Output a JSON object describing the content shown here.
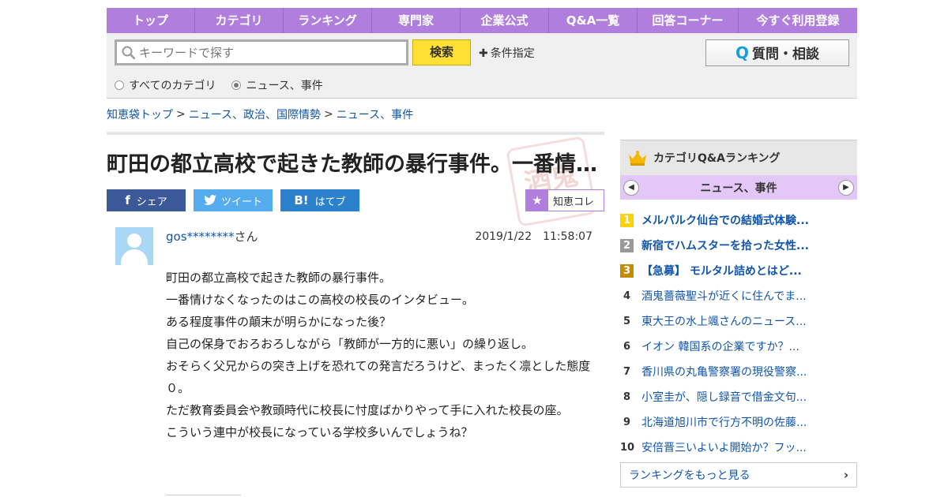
{
  "nav": {
    "items": [
      "トップ",
      "カテゴリ",
      "ランキング",
      "専門家",
      "企業公式",
      "Q&A一覧",
      "回答コーナー",
      "今すぐ利用登録"
    ]
  },
  "search": {
    "placeholder": "キーワードで探す",
    "button_label": "検索",
    "condition_label": "条件指定",
    "ask_label": "質問・相談",
    "radio_all": "すべてのカテゴリ",
    "radio_current": "ニュース、事件",
    "selected": "ニュース、事件"
  },
  "breadcrumb": {
    "items": [
      "知恵袋トップ",
      "ニュース、政治、国際情勢",
      "ニュース、事件"
    ],
    "separator": ">"
  },
  "question": {
    "title": "町田の都立高校で起きた教師の暴行事件。一番情けなくなったのはこの高校の校長のインタビュー。",
    "user_name": "gos********",
    "user_suffix": "さん",
    "timestamp": "2019/1/22　11:58:07",
    "body": [
      "町田の都立高校で起きた教師の暴行事件。",
      "一番情けなくなったのはこの高校の校長のインタビュー。",
      "ある程度事件の顛末が明らかになった後？",
      "自己の保身でおろおろしながら「教師が一方的に悪い」の繰り返し。",
      "おそらく父兄からの突き上げを恐れての発言だろうけど、まったく凛とした態度０。",
      "ただ教育委員会や教頭時代に校長に忖度ばかりやって手に入れた校長の座。",
      "こういう連中が校長になっている学校多いんでしょうね？"
    ],
    "stamp_text": "酒鬼"
  },
  "share": {
    "facebook": "シェア",
    "twitter": "ツイート",
    "hatena": "はてブ",
    "chiecolle": "知恵コレ"
  },
  "sidebar": {
    "title": "カテゴリQ&Aランキング",
    "category": "ニュース、事件",
    "ranking": [
      {
        "rank": "1",
        "text": "メルパルク仙台での結婚式体験..."
      },
      {
        "rank": "2",
        "text": "新宿でハムスターを拾った女性..."
      },
      {
        "rank": "3",
        "text": "【急募】 モルタル詰めとはど..."
      },
      {
        "rank": "4",
        "text": "酒鬼薔薇聖斗が近くに住んでま..."
      },
      {
        "rank": "5",
        "text": "東大王の水上颯さんのニュース..."
      },
      {
        "rank": "6",
        "text": "イオン 韓国系の企業ですか？..."
      },
      {
        "rank": "7",
        "text": "香川県の丸亀警察署の現役警察..."
      },
      {
        "rank": "8",
        "text": "小室圭が、隠し録音で借金文句..."
      },
      {
        "rank": "9",
        "text": "北海道旭川市で行方不明の佐藤..."
      },
      {
        "rank": "10",
        "text": "安倍晋三いよいよ開始か？フッ..."
      }
    ],
    "more_label": "ランキングをもっと見る"
  }
}
